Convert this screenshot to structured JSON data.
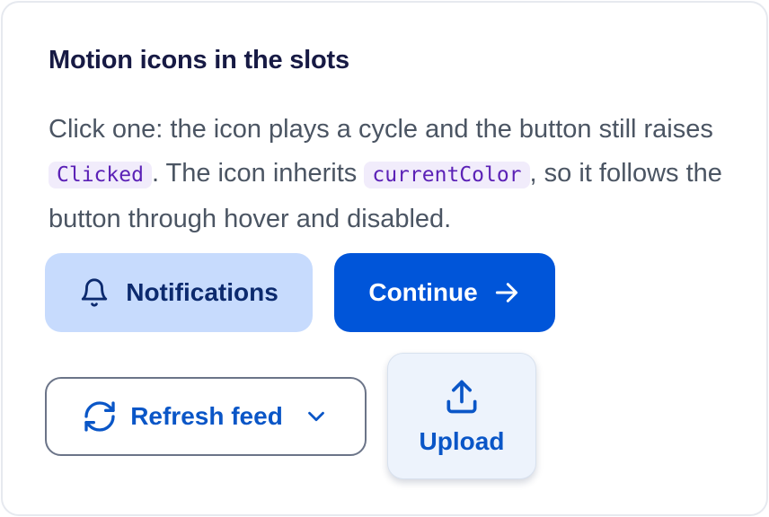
{
  "card": {
    "title": "Motion icons in the slots",
    "desc_part1": "Click one: the icon plays a cycle and the button still raises ",
    "code1": "Clicked",
    "desc_part2": ". The icon inherits ",
    "code2": "currentColor",
    "desc_part3": ", so it follows the button through hover and disabled."
  },
  "buttons": {
    "notifications": {
      "label": "Notifications",
      "icon": "bell-icon"
    },
    "continue": {
      "label": "Continue",
      "icon": "arrow-right-icon"
    },
    "refresh": {
      "label": "Refresh feed",
      "icon": "refresh-icon",
      "trailing_icon": "chevron-down-icon"
    },
    "upload": {
      "label": "Upload",
      "icon": "upload-icon"
    }
  },
  "colors": {
    "title": "#171a44",
    "body_text": "#4b5563",
    "code_text": "#5b21b6",
    "code_bg": "#f1ecfb",
    "notif_bg": "#c7dbfd",
    "primary": "#0055d9",
    "link_blue": "#0a56c7",
    "upload_bg": "#edf3fc"
  }
}
